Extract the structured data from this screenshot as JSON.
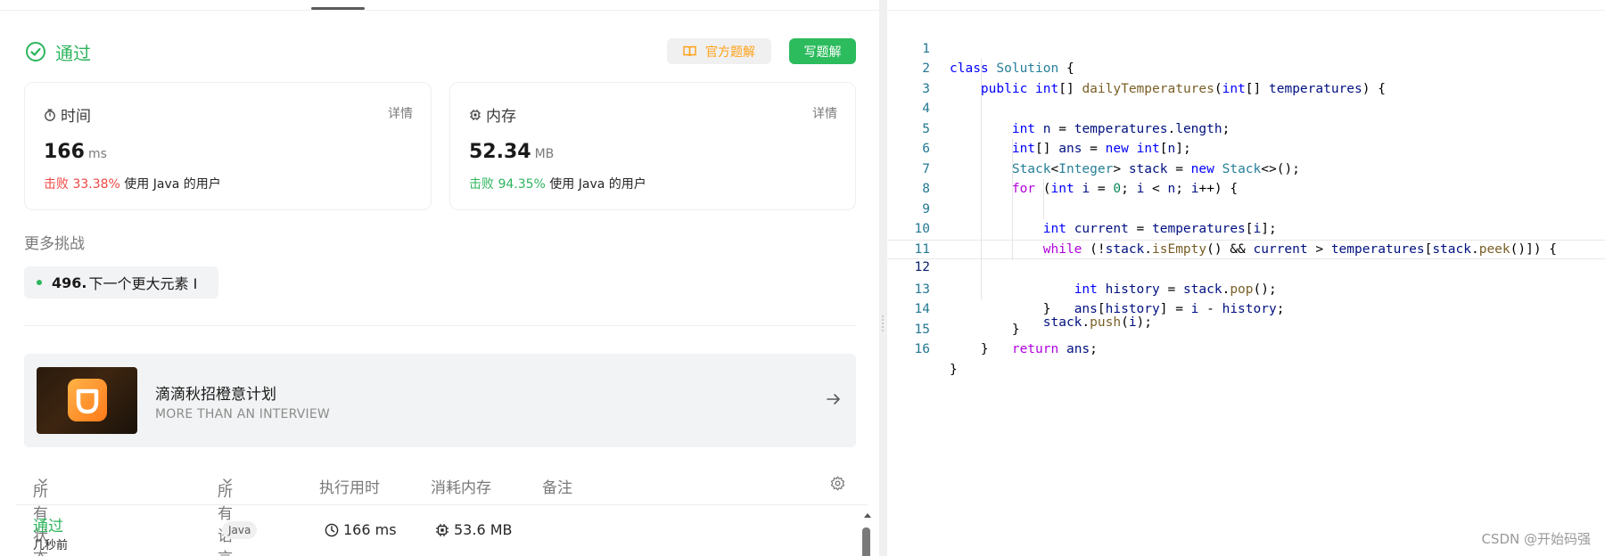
{
  "result": {
    "status": "通过",
    "buttons": {
      "official": "官方题解",
      "write": "写题解"
    },
    "time": {
      "label": "时间",
      "detail": "详情",
      "value": "166",
      "unit": "ms",
      "beat_label": "击败",
      "beat": "33.38%",
      "suffix": "使用 Java 的用户"
    },
    "memory": {
      "label": "内存",
      "detail": "详情",
      "value": "52.34",
      "unit": "MB",
      "beat_label": "击败",
      "beat": "94.35%",
      "suffix": "使用 Java 的用户"
    }
  },
  "more": {
    "title": "更多挑战",
    "items": [
      {
        "num": "496.",
        "name": "下一个更大元素 I"
      }
    ]
  },
  "promo": {
    "title": "滴滴秋招橙意计划",
    "subtitle": "MORE THAN AN INTERVIEW"
  },
  "submissions": {
    "headers": {
      "status": "所有状态",
      "lang": "所有语言",
      "time": "执行用时",
      "memory": "消耗内存",
      "note": "备注"
    },
    "rows": [
      {
        "status": "通过",
        "when": "几秒前",
        "lang": "Java",
        "time": "166 ms",
        "memory": "53.6 MB"
      }
    ]
  },
  "editor": {
    "lines": [
      {
        "n": "1"
      },
      {
        "n": "2"
      },
      {
        "n": "3"
      },
      {
        "n": "4"
      },
      {
        "n": "5"
      },
      {
        "n": "6"
      },
      {
        "n": "7"
      },
      {
        "n": "8"
      },
      {
        "n": "9"
      },
      {
        "n": "10"
      },
      {
        "n": "11"
      },
      {
        "n": "12"
      },
      {
        "n": "13"
      },
      {
        "n": "14"
      },
      {
        "n": "15"
      },
      {
        "n": "16"
      }
    ],
    "code": [
      "class Solution {",
      "    public int[] dailyTemperatures(int[] temperatures) {",
      "        int n = temperatures.length;",
      "        int[] ans = new int[n];",
      "        Stack<Integer> stack = new Stack<>();",
      "        for (int i = 0; i < n; i++) {",
      "            int current = temperatures[i];",
      "            while (!stack.isEmpty() && current > temperatures[stack.peek()]) {",
      "                int history = stack.pop();",
      "                ans[history] = i - history;",
      "            }",
      "            stack.push(i);",
      "        }",
      "        return ans;",
      "    }",
      "}"
    ],
    "active_line": 12
  },
  "watermark": "CSDN @开始码强",
  "colors": {
    "accent_green": "#2db55d",
    "button_green": "#2cbb5d",
    "fail_red": "#ef4743",
    "official_orange": "#ffa116"
  }
}
